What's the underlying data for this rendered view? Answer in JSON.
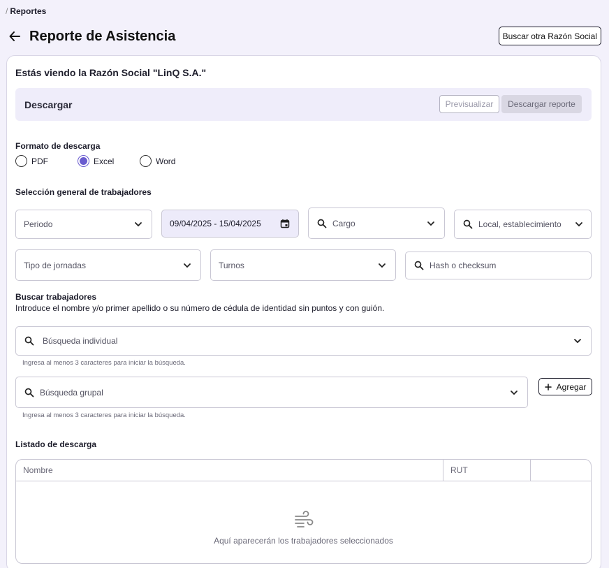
{
  "breadcrumb": {
    "separator": "/",
    "current": "Reportes"
  },
  "header": {
    "title": "Reporte de Asistencia",
    "other_company_button": "Buscar otra Razón Social"
  },
  "company_notice": "Estás viendo la Razón Social \"LinQ S.A.\"",
  "download": {
    "title": "Descargar",
    "preview_button": "Previsualizar",
    "download_button": "Descargar reporte"
  },
  "format": {
    "label": "Formato de descarga",
    "options": [
      {
        "label": "PDF",
        "checked": false
      },
      {
        "label": "Excel",
        "checked": true
      },
      {
        "label": "Word",
        "checked": false
      }
    ]
  },
  "general_selection": {
    "label": "Selección general de trabajadores",
    "periodo": "Periodo",
    "date_range": "09/04/2025 - 15/04/2025",
    "cargo": "Cargo",
    "local": "Local, establecimiento",
    "tipo_jornadas": "Tipo de jornadas",
    "turnos": "Turnos",
    "hash": "Hash o checksum"
  },
  "search_workers": {
    "label": "Buscar trabajadores",
    "description": "Introduce el nombre y/o primer apellido o su número de cédula de identidad sin puntos y con guión.",
    "individual_placeholder": "Búsqueda individual",
    "individual_helper": "Ingresa al menos 3 caracteres para iniciar la búsqueda.",
    "group_placeholder": "Búsqueda grupal",
    "group_helper": "Ingresa al menos 3 caracteres para iniciar la búsqueda.",
    "add_button": "Agregar"
  },
  "download_list": {
    "label": "Listado de descarga",
    "columns": [
      "Nombre",
      "RUT",
      ""
    ],
    "empty_text": "Aquí aparecerán los trabajadores seleccionados"
  },
  "colors": {
    "accent": "#6a5ccf",
    "background": "#f3f1fb",
    "bar": "#efedfa"
  }
}
